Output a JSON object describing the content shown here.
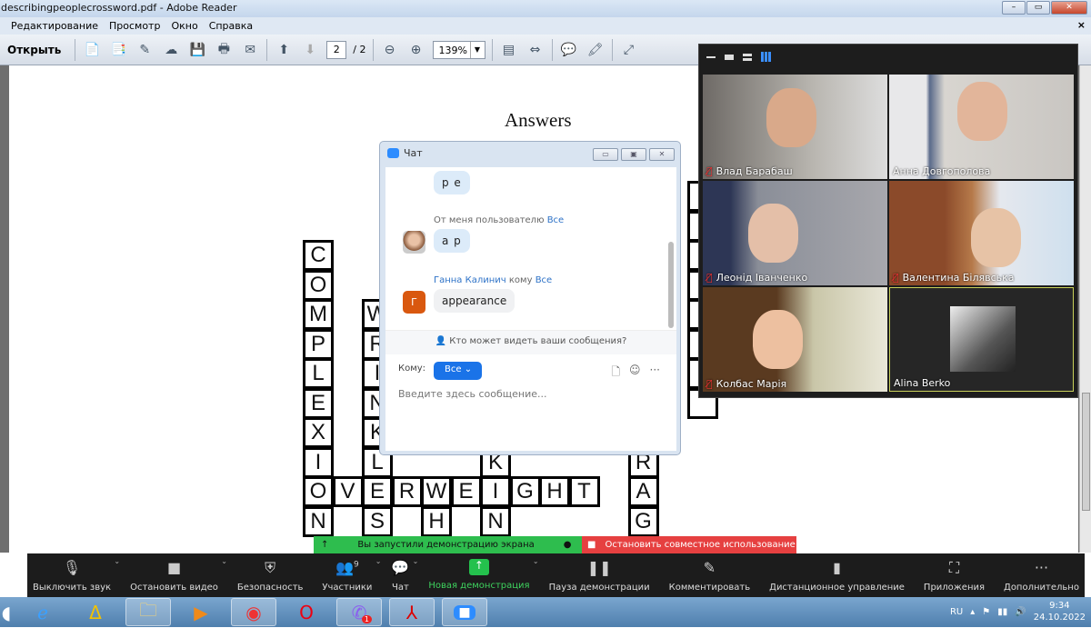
{
  "window": {
    "title": "describingpeoplecrossword.pdf - Adobe Reader",
    "close_glyph": "×"
  },
  "menu": [
    "Редактирование",
    "Просмотр",
    "Окно",
    "Справка"
  ],
  "toolbar": {
    "open_label": "Открыть",
    "page_current": "2",
    "page_total": "/ 2",
    "zoom": "139%"
  },
  "document": {
    "heading": "Answers",
    "cells": [
      {
        "c": 0,
        "r": 0,
        "t": "C"
      },
      {
        "c": 0,
        "r": 1,
        "t": "O"
      },
      {
        "c": 0,
        "r": 2,
        "t": "M"
      },
      {
        "c": 0,
        "r": 3,
        "t": "P"
      },
      {
        "c": 0,
        "r": 4,
        "t": "L"
      },
      {
        "c": 0,
        "r": 5,
        "t": "E"
      },
      {
        "c": 0,
        "r": 6,
        "t": "X"
      },
      {
        "c": 0,
        "r": 7,
        "t": "I"
      },
      {
        "c": 0,
        "r": 8,
        "t": "O"
      },
      {
        "c": 0,
        "r": 9,
        "t": "N"
      },
      {
        "c": 2,
        "r": 2,
        "t": "W"
      },
      {
        "c": 2,
        "r": 3,
        "t": "R"
      },
      {
        "c": 2,
        "r": 4,
        "t": "I"
      },
      {
        "c": 2,
        "r": 5,
        "t": "N"
      },
      {
        "c": 2,
        "r": 6,
        "t": "K"
      },
      {
        "c": 2,
        "r": 7,
        "t": "L"
      },
      {
        "c": 2,
        "r": 9,
        "t": "S"
      },
      {
        "c": 1,
        "r": 8,
        "t": "V"
      },
      {
        "c": 2,
        "r": 8,
        "t": "E"
      },
      {
        "c": 3,
        "r": 8,
        "t": "R"
      },
      {
        "c": 4,
        "r": 8,
        "t": "W"
      },
      {
        "c": 5,
        "r": 8,
        "t": "E"
      },
      {
        "c": 6,
        "r": 8,
        "t": "I"
      },
      {
        "c": 7,
        "r": 8,
        "t": "G"
      },
      {
        "c": 8,
        "r": 8,
        "t": "H"
      },
      {
        "c": 9,
        "r": 8,
        "t": "T"
      },
      {
        "c": 4,
        "r": 9,
        "t": "H"
      },
      {
        "c": 6,
        "r": 7,
        "t": "K"
      },
      {
        "c": 6,
        "r": 9,
        "t": "N"
      },
      {
        "c": 11,
        "r": 7,
        "t": "R"
      },
      {
        "c": 11,
        "r": 8,
        "t": "A"
      },
      {
        "c": 11,
        "r": 9,
        "t": "G"
      }
    ]
  },
  "chat": {
    "title": "Чат",
    "messages": [
      {
        "text": "p e"
      },
      {
        "meta": "От меня пользователю",
        "to": "Все",
        "text": "a p"
      },
      {
        "sender": "Ганна Калинич",
        "meta": "кому",
        "to": "Все",
        "avatar": "Г",
        "text": "appearance"
      }
    ],
    "privacy": "Кто может видеть ваши сообщения?",
    "to_label": "Кому:",
    "to_value": "Все",
    "placeholder": "Введите здесь сообщение..."
  },
  "gallery": {
    "participants": [
      {
        "name": "Влад Барабаш",
        "muted": true
      },
      {
        "name": "Анна Довгополова",
        "muted": false
      },
      {
        "name": "Леонід Іванченко",
        "muted": true
      },
      {
        "name": "Валентина Білявська",
        "muted": true
      },
      {
        "name": "Колбас Марія",
        "muted": true
      },
      {
        "name": "Alina Berko",
        "muted": false
      }
    ]
  },
  "share": {
    "status": "Вы запустили демонстрацию экрана",
    "stop": "Остановить совместное использование"
  },
  "zoombar": [
    {
      "label": "Выключить звук",
      "icon": "microphone-icon"
    },
    {
      "label": "Остановить видео",
      "icon": "video-camera-icon"
    },
    {
      "label": "Безопасность",
      "icon": "shield-icon"
    },
    {
      "label": "Участники",
      "icon": "participants-icon",
      "count": "9"
    },
    {
      "label": "Чат",
      "icon": "chat-icon"
    },
    {
      "label": "Новая демонстрация",
      "icon": "share-screen-icon"
    },
    {
      "label": "Пауза демонстрации",
      "icon": "pause-icon"
    },
    {
      "label": "Комментировать",
      "icon": "pencil-icon"
    },
    {
      "label": "Дистанционное управление",
      "icon": "mouse-icon"
    },
    {
      "label": "Приложения",
      "icon": "apps-icon"
    },
    {
      "label": "Дополнительно",
      "icon": "more-icon"
    }
  ],
  "taskbar": {
    "lang": "RU",
    "time": "9:34",
    "date": "24.10.2022",
    "viber_badge": "1"
  },
  "colors": {
    "zoom_blue": "#2d8cff",
    "share_green": "#2ebd4e",
    "stop_red": "#e64040"
  }
}
